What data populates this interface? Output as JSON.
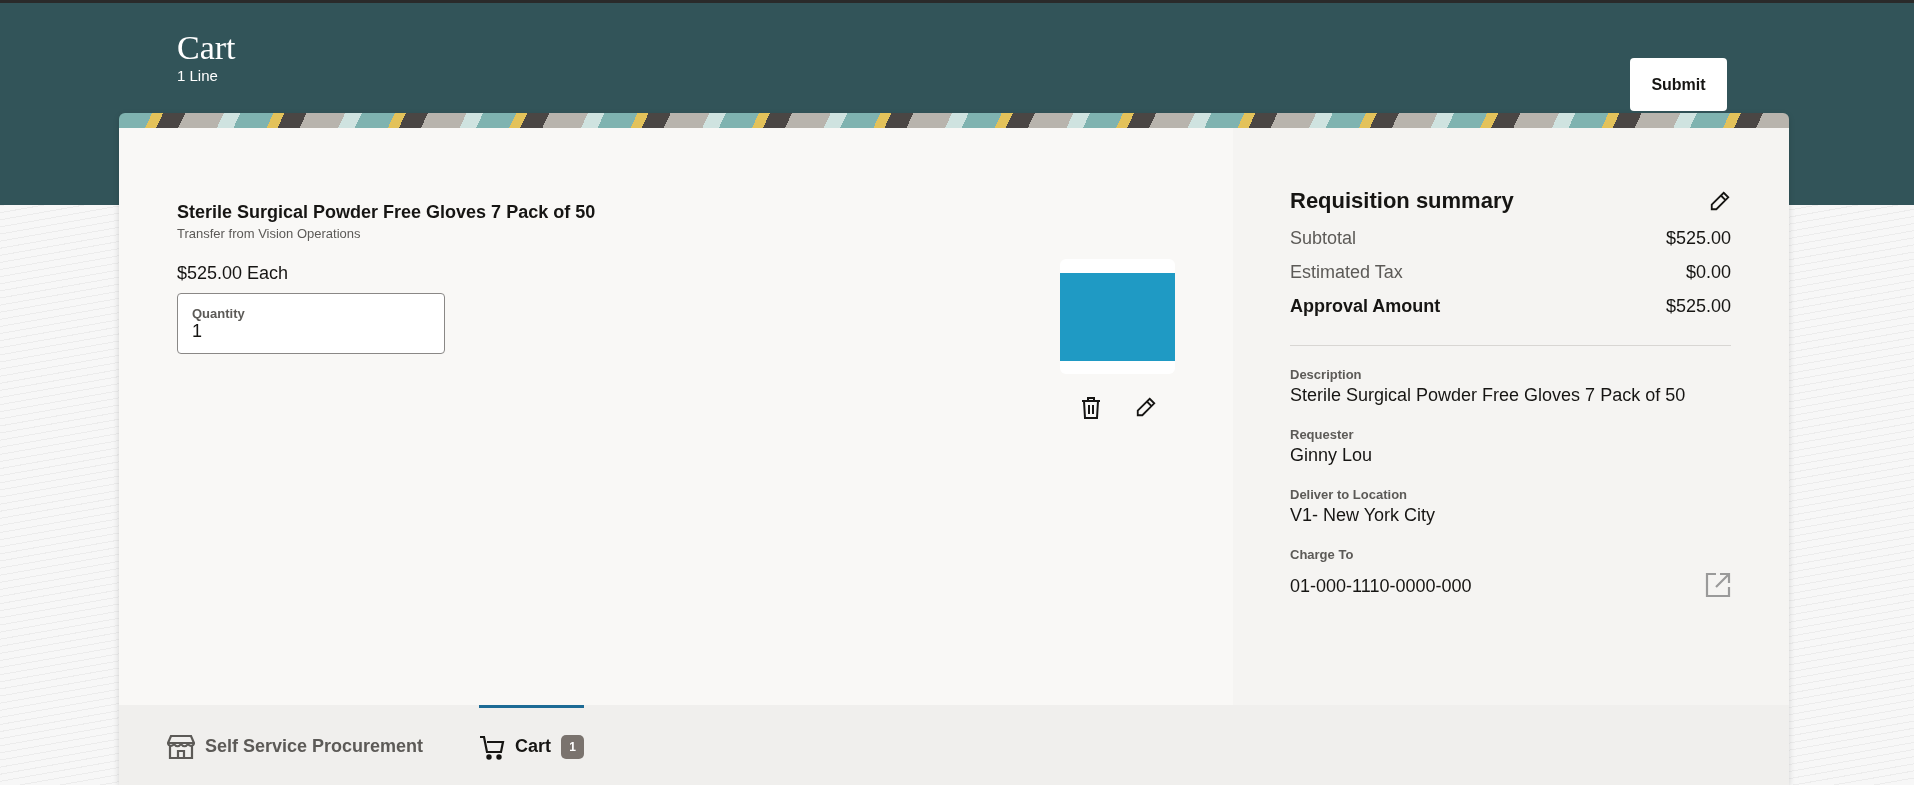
{
  "header": {
    "title": "Cart",
    "subtitle": "1 Line",
    "submit_button": "Submit"
  },
  "line": {
    "title": "Sterile Surgical Powder Free Gloves 7 Pack of 50",
    "subtitle": "Transfer from Vision Operations",
    "price": "$525.00 Each",
    "quantity": {
      "label": "Quantity",
      "value": "1"
    }
  },
  "summary": {
    "title": "Requisition summary",
    "totals": [
      {
        "label": "Subtotal",
        "value": "$525.00",
        "kind": "normal"
      },
      {
        "label": "Estimated Tax",
        "value": "$0.00",
        "kind": "normal"
      },
      {
        "label": "Approval Amount",
        "value": "$525.00",
        "kind": "total"
      }
    ],
    "details": [
      {
        "label": "Description",
        "value": "Sterile Surgical Powder Free Gloves 7 Pack of 50",
        "kind": "text"
      },
      {
        "label": "Requester",
        "value": "Ginny Lou",
        "kind": "text"
      },
      {
        "label": "Deliver to Location",
        "value": "V1- New York City",
        "kind": "text"
      },
      {
        "label": "Charge To",
        "value": "01-000-1110-0000-000",
        "kind": "account"
      }
    ]
  },
  "tabs": [
    {
      "label": "Self Service Procurement",
      "selected": false,
      "kind": "store"
    },
    {
      "label": "Cart",
      "selected": true,
      "kind": "cart",
      "badge": "1"
    }
  ]
}
